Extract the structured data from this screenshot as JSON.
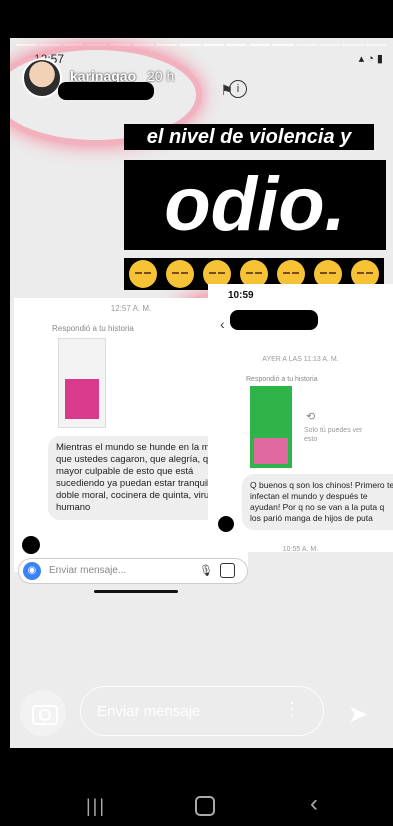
{
  "story": {
    "username": "karinagao",
    "time_ago": "20 h",
    "clock": "12:57"
  },
  "overlay": {
    "headline": "el nivel de violencia y",
    "bigword": "odio.",
    "emoji": [
      "pensive-face",
      "pensive-face",
      "pensive-face",
      "pensive-face",
      "pensive-face",
      "pensive-face",
      "pensive-face"
    ]
  },
  "left_chat": {
    "timestamp": "12:57 A. M.",
    "replied_label": "Respondió a tu historia",
    "message": "Mientras el mundo se hunde en la mierda que ustedes cagaron, que alegría, que el mayor culpable de esto que está sucediendo ya puedan estar tranquilos, doble moral, cocinera de quinta, virus humano",
    "input_placeholder": "Enviar mensaje..."
  },
  "right_chat": {
    "clock": "10:59",
    "timestamp": "AYER A LAS 11:13 A. M.",
    "replied_label": "Respondió a tu historia",
    "history_note": "Solo tú puedes ver esto",
    "message": "Q buenos q son los chinos! Primero te infectan el mundo y después te ayudan! Por q no se van a la puta q los parió manga de hijos de puta",
    "timestamp_2": "10:55 A. M."
  },
  "reply": {
    "placeholder": "Enviar mensaje"
  }
}
